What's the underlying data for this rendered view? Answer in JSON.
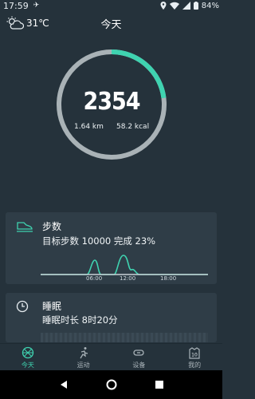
{
  "status_bar": {
    "time": "17:59",
    "battery": "84%"
  },
  "header": {
    "weather_temp": "31℃",
    "title": "今天"
  },
  "summary": {
    "steps": "2354",
    "distance": "1.64 km",
    "calories": "58.2 kcal",
    "progress": 0.23
  },
  "steps_card": {
    "title": "步数",
    "description": "目标步数 10000 完成 23%",
    "ticks": [
      "06:00",
      "12:00",
      "18:00"
    ]
  },
  "sleep_card": {
    "title": "睡眠",
    "description": "睡眠时长 8时20分"
  },
  "tabs": [
    {
      "label": "今天",
      "icon": "basketball-icon",
      "active": true
    },
    {
      "label": "运动",
      "icon": "run-icon",
      "active": false
    },
    {
      "label": "设备",
      "icon": "band-icon",
      "active": false
    },
    {
      "label": "我的",
      "icon": "badge-icon",
      "badge": "10",
      "active": false
    }
  ],
  "colors": {
    "accent": "#3fd3b0",
    "ring_track": "#a9b2b6",
    "background": "#25323b",
    "card": "#2f3d47"
  }
}
